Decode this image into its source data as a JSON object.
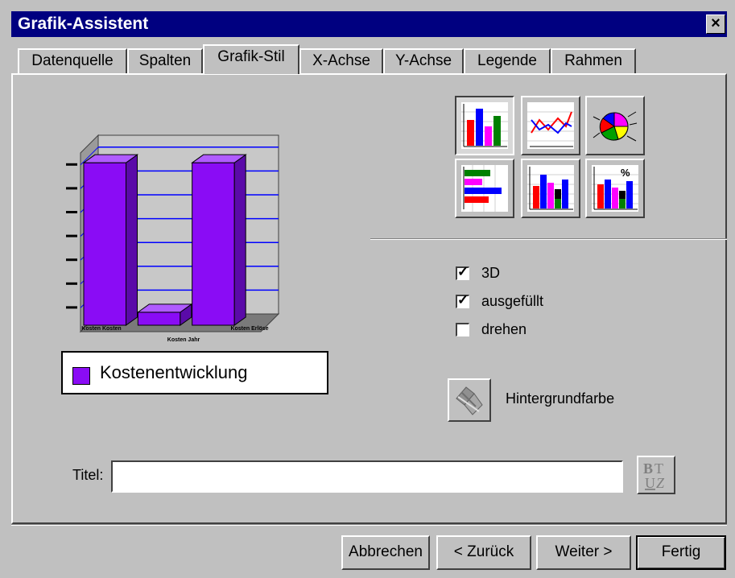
{
  "window": {
    "title": "Grafik-Assistent",
    "close_glyph": "×"
  },
  "tabs": [
    {
      "label": "Datenquelle"
    },
    {
      "label": "Spalten"
    },
    {
      "label": "Grafik-Stil",
      "active": true
    },
    {
      "label": "X-Achse"
    },
    {
      "label": "Y-Achse"
    },
    {
      "label": "Legende"
    },
    {
      "label": "Rahmen"
    }
  ],
  "chart_preview": {
    "legend_label": "Kostenentwicklung",
    "legend_color": "#8a0cf5",
    "x_labels": [
      "Kosten Kosten",
      "Kosten Erlöse"
    ],
    "x_title": "Kosten Jahr"
  },
  "chart_data": {
    "type": "bar",
    "categories": [
      "Kosten Kosten",
      "",
      "Kosten Erlöse"
    ],
    "series": [
      {
        "name": "Kostenentwicklung",
        "values": [
          100,
          8,
          100
        ]
      }
    ],
    "xlabel": "Kosten Jahr",
    "ylabel": "",
    "ylim": [
      0,
      110
    ],
    "grid": true,
    "three_d": true,
    "bar_color": "#8a0cf5",
    "grid_color": "#0000ff"
  },
  "chart_types": [
    {
      "icon": "bar-chart-icon",
      "selected": true
    },
    {
      "icon": "line-chart-icon"
    },
    {
      "icon": "pie-chart-icon"
    },
    {
      "icon": "horizontal-bar-chart-icon"
    },
    {
      "icon": "stacked-bar-chart-icon"
    },
    {
      "icon": "percent-stacked-bar-chart-icon"
    }
  ],
  "options": {
    "three_d": {
      "label": "3D",
      "checked": true
    },
    "filled": {
      "label": "ausgefüllt",
      "checked": true
    },
    "rotate": {
      "label": "drehen",
      "checked": false
    }
  },
  "background": {
    "label": "Hintergrundfarbe",
    "icon": "paint-roller-icon"
  },
  "title_field": {
    "label": "Titel:",
    "value": "",
    "format_icon": "text-format-icon"
  },
  "buttons": {
    "cancel": "Abbrechen",
    "back": "< Zurück",
    "next": "Weiter >",
    "finish": "Fertig"
  }
}
